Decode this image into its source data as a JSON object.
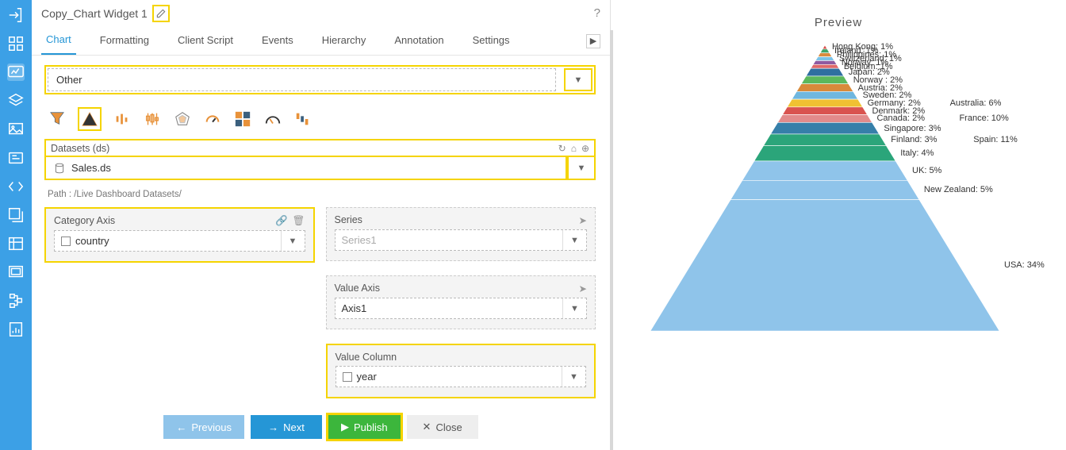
{
  "title": "Copy_Chart Widget 1",
  "tabs": [
    "Chart",
    "Formatting",
    "Client Script",
    "Events",
    "Hierarchy",
    "Annotation",
    "Settings"
  ],
  "chart_type_label": "Other",
  "datasets_label": "Datasets (ds)",
  "dataset_value": "Sales.ds",
  "path_label": "Path : /Live Dashboard Datasets/",
  "category_label": "Category Axis",
  "category_value": "country",
  "series_label": "Series",
  "series_value": "Series1",
  "value_axis_label": "Value Axis",
  "value_axis_value": "Axis1",
  "value_column_label": "Value Column",
  "value_column_value": "year",
  "buttons": {
    "prev": "Previous",
    "next": "Next",
    "publish": "Publish",
    "close": "Close"
  },
  "preview_title": "Preview",
  "chart_data": {
    "type": "pyramid",
    "title": "Preview",
    "series": [
      {
        "name": "Hong Kong",
        "value": 1,
        "color": "#d9534f"
      },
      {
        "name": "Ireland",
        "value": 1,
        "color": "#3fa66a"
      },
      {
        "name": "Philippines",
        "value": 1,
        "color": "#d98b3e"
      },
      {
        "name": "Switzerland",
        "value": 1,
        "color": "#7cc3e8"
      },
      {
        "name": "Norway",
        "value": 1,
        "color": "#8f5aa0"
      },
      {
        "name": "Belgium",
        "value": 1,
        "color": "#e06a6a"
      },
      {
        "name": "Japan",
        "value": 2,
        "color": "#2f6fa0"
      },
      {
        "name": "Norway ",
        "value": 2,
        "color": "#5bb85c"
      },
      {
        "name": "Austria",
        "value": 2,
        "color": "#d88a3a"
      },
      {
        "name": "Sweden",
        "value": 2,
        "color": "#6fb7df"
      },
      {
        "name": "Germany",
        "value": 2,
        "color": "#f0c132",
        "extra": {
          "name": "Australia",
          "value": 6
        }
      },
      {
        "name": "Denmark",
        "value": 2,
        "color": "#d9534f"
      },
      {
        "name": "Canada",
        "value": 2,
        "color": "#e28b8b",
        "extra": {
          "name": "France",
          "value": 10
        }
      },
      {
        "name": "Singapore",
        "value": 3,
        "color": "#367fa9"
      },
      {
        "name": "Finland",
        "value": 3,
        "color": "#2ba57a",
        "extra": {
          "name": "Spain",
          "value": 11
        }
      },
      {
        "name": "Italy",
        "value": 4,
        "color": "#2ba57a"
      },
      {
        "name": "UK",
        "value": 5,
        "color": "#8fc4ea"
      },
      {
        "name": "New Zealand",
        "value": 5,
        "color": "#8fc4ea"
      },
      {
        "name": "USA",
        "value": 34,
        "color": "#8fc4ea"
      }
    ]
  }
}
